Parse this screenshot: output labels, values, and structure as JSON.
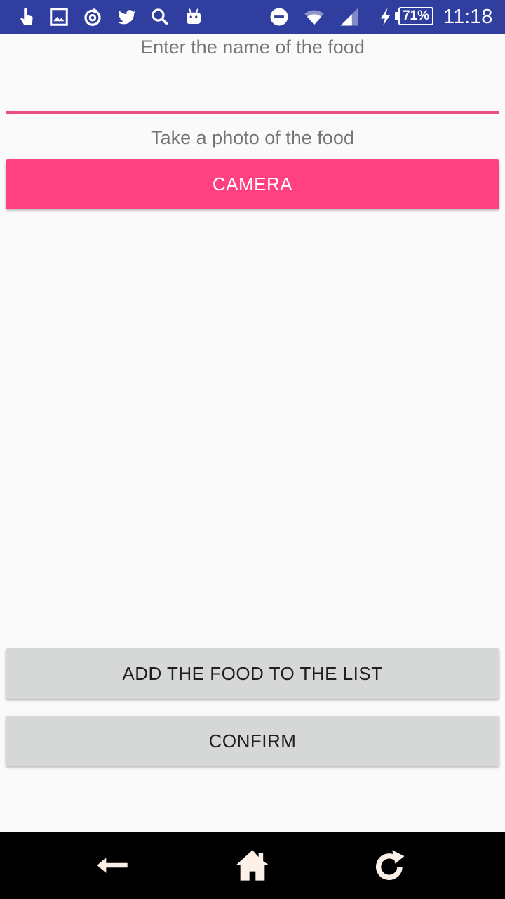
{
  "status_bar": {
    "battery": "71%",
    "time": "11:18",
    "icons": [
      "touch-icon",
      "image-icon",
      "sync-circle-icon",
      "twitter-icon",
      "search-icon",
      "android-icon",
      "do-not-disturb-icon",
      "wifi-icon",
      "signal-icon",
      "charging-icon",
      "battery-icon"
    ]
  },
  "form": {
    "name_label": "Enter the name of the food",
    "name_value": "",
    "photo_label": "Take a photo of the food",
    "camera_button": "CAMERA",
    "add_button": "ADD THE FOOD TO THE LIST",
    "confirm_button": "CONFIRM"
  },
  "nav_bar": {
    "icons": [
      "back-icon",
      "home-icon",
      "refresh-icon"
    ]
  },
  "colors": {
    "status_bar": "#303f9f",
    "accent": "#ff4081",
    "field_underline": "#e94e84",
    "secondary_button": "#d6d7d7",
    "background": "#fafafa",
    "nav_bar": "#000000"
  }
}
